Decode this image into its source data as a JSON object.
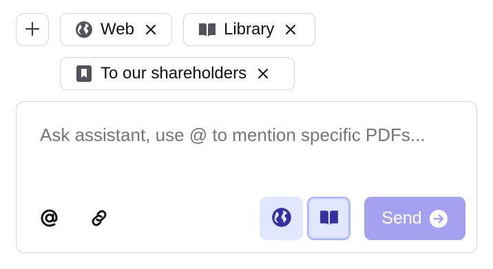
{
  "context_chips": [
    {
      "label": "Web",
      "icon": "globe-icon"
    },
    {
      "label": "Library",
      "icon": "book-open-icon"
    },
    {
      "label": "To our shareholders",
      "icon": "bookmark-icon"
    }
  ],
  "add_context": {
    "icon": "plus-icon"
  },
  "composer": {
    "placeholder": "Ask assistant, use @ to mention specific PDFs...",
    "value": ""
  },
  "toolbar": {
    "mention_icon": "at-sign-icon",
    "attach_icon": "paperclip-icon",
    "web_toggle_icon": "globe-icon",
    "library_toggle_icon": "book-open-icon",
    "send_label": "Send",
    "send_icon": "arrow-right-circle-icon"
  },
  "colors": {
    "accent": "#4338ca",
    "accent_light": "#e0e7ff",
    "send_bg": "#a5a0ef",
    "border": "#d4d4d8",
    "placeholder": "#a1a1aa",
    "chip_icon": "#52525b"
  }
}
